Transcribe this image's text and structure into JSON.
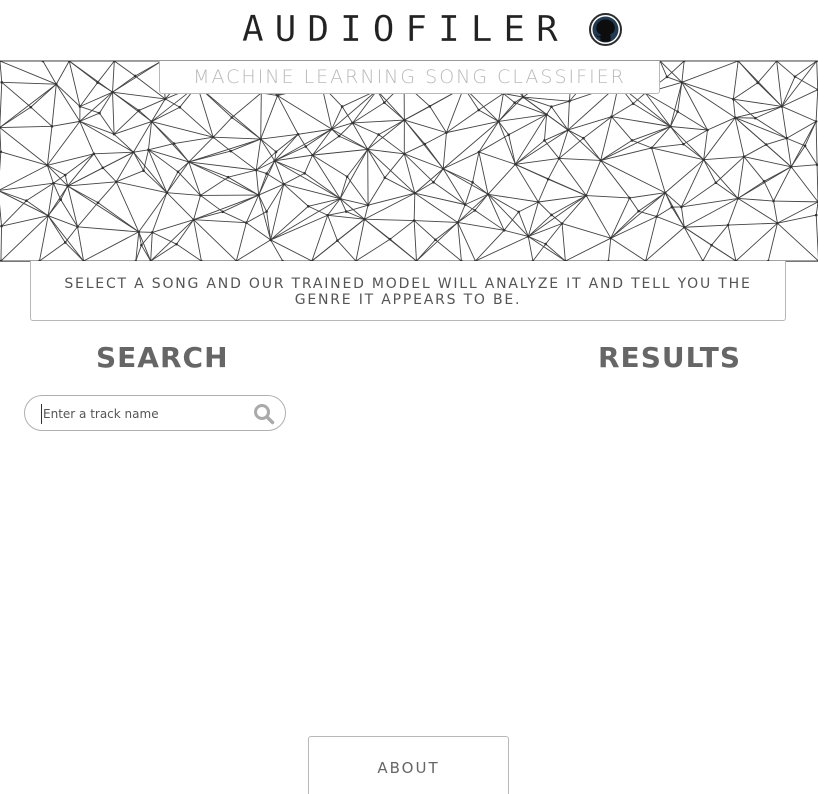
{
  "header": {
    "logo_text": "AUDIOFILER",
    "github_icon": "github-octocat-icon"
  },
  "banner": {
    "subtitle": "MACHINE LEARNING SONG CLASSIFIER",
    "pattern": "low-poly triangulated mesh"
  },
  "description": "SELECT A SONG AND OUR TRAINED MODEL WILL ANALYZE IT AND TELL YOU THE GENRE IT APPEARS TO BE.",
  "search": {
    "title": "SEARCH",
    "placeholder": "Enter a track name",
    "icon": "search-icon"
  },
  "results": {
    "title": "RESULTS"
  },
  "footer": {
    "about_label": "ABOUT"
  },
  "colors": {
    "text_dark": "#222222",
    "text_gray": "#666666",
    "border": "#b8b8b8",
    "mesh_line": "#444444"
  }
}
